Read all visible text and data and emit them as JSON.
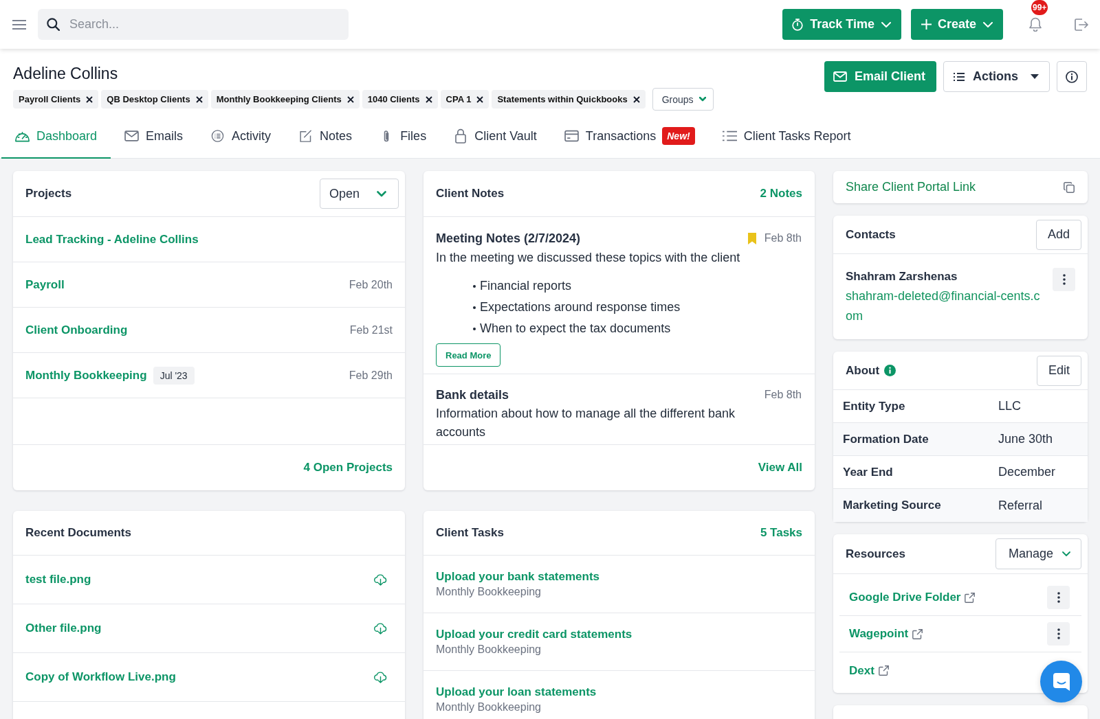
{
  "top_bar": {
    "search": {
      "placeholder": "Search..."
    },
    "buttons": [
      {
        "label": "Track Time",
        "kind": "timer"
      },
      {
        "label": "Create",
        "kind": "create"
      }
    ],
    "notifications": {
      "badge": "99+"
    }
  },
  "client": {
    "name": "Adeline Collins",
    "tags": [
      {
        "label": "Payroll Clients"
      },
      {
        "label": "QB Desktop Clients"
      },
      {
        "label": "Monthly Bookkeeping Clients"
      },
      {
        "label": "1040 Clients"
      },
      {
        "label": "CPA 1"
      },
      {
        "label": "Statements within Quickbooks"
      }
    ],
    "groups_button": "Groups",
    "email_button": "Email Client",
    "actions_button": "Actions"
  },
  "tabs": [
    {
      "label": "Dashboard",
      "selected": true
    },
    {
      "label": "Emails",
      "selected": false
    },
    {
      "label": "Activity",
      "selected": false
    },
    {
      "label": "Notes",
      "selected": false
    },
    {
      "label": "Files",
      "selected": false
    },
    {
      "label": "Client Vault",
      "selected": false
    },
    {
      "label": "Transactions",
      "selected": false,
      "badge": "New!"
    },
    {
      "label": "Client Tasks Report",
      "selected": false
    }
  ],
  "projects": {
    "title": "Projects",
    "filter": "Open",
    "rows": [
      {
        "name": "Lead Tracking - Adeline Collins"
      },
      {
        "name": "Payroll",
        "date": "Feb 20th"
      },
      {
        "name": "Client Onboarding",
        "date": "Feb 21st"
      },
      {
        "name": "Monthly Bookkeeping",
        "tag": "Jul '23",
        "date": "Feb 29th"
      }
    ],
    "footer": "4 Open Projects"
  },
  "recent_documents": {
    "title": "Recent Documents",
    "files": [
      "test file.png",
      "Other file.png",
      "Copy of Workflow Live.png"
    ]
  },
  "client_notes": {
    "title": "Client Notes",
    "count": "2 Notes",
    "notes": [
      {
        "title": "Meeting Notes (2/7/2024)",
        "date": "Feb 8th",
        "bookmarked": true,
        "text": "In the meeting we discussed these topics with the client",
        "bullets": [
          "Financial reports",
          "Expectations around response times",
          "When to expect the tax documents"
        ],
        "read_more": "Read More"
      },
      {
        "title": "Bank details",
        "date": "Feb 8th",
        "bookmarked": false,
        "text": "Information about how to manage all the different bank accounts"
      }
    ],
    "footer": "View All"
  },
  "client_tasks": {
    "title": "Client Tasks",
    "count": "5 Tasks",
    "tasks": [
      {
        "title": "Upload your bank statements",
        "project": "Monthly Bookkeeping"
      },
      {
        "title": "Upload your credit card statements",
        "project": "Monthly Bookkeeping"
      },
      {
        "title": "Upload your loan statements",
        "project": "Monthly Bookkeeping"
      }
    ]
  },
  "portal": {
    "label": "Share Client Portal Link"
  },
  "contacts": {
    "title": "Contacts",
    "add_button": "Add",
    "people": [
      {
        "name": "Shahram Zarshenas",
        "email": "shahram-deleted@financial-cents.com"
      }
    ]
  },
  "about": {
    "title": "About",
    "edit_button": "Edit",
    "fields": [
      {
        "label": "Entity Type",
        "value": "LLC"
      },
      {
        "label": "Formation Date",
        "value": "June 30th"
      },
      {
        "label": "Year End",
        "value": "December"
      },
      {
        "label": "Marketing Source",
        "value": "Referral"
      }
    ]
  },
  "resources": {
    "title": "Resources",
    "manage_button": "Manage",
    "links": [
      {
        "label": "Google Drive Folder",
        "menu": true
      },
      {
        "label": "Wagepoint",
        "menu": true
      },
      {
        "label": "Dext",
        "menu": false
      }
    ]
  }
}
